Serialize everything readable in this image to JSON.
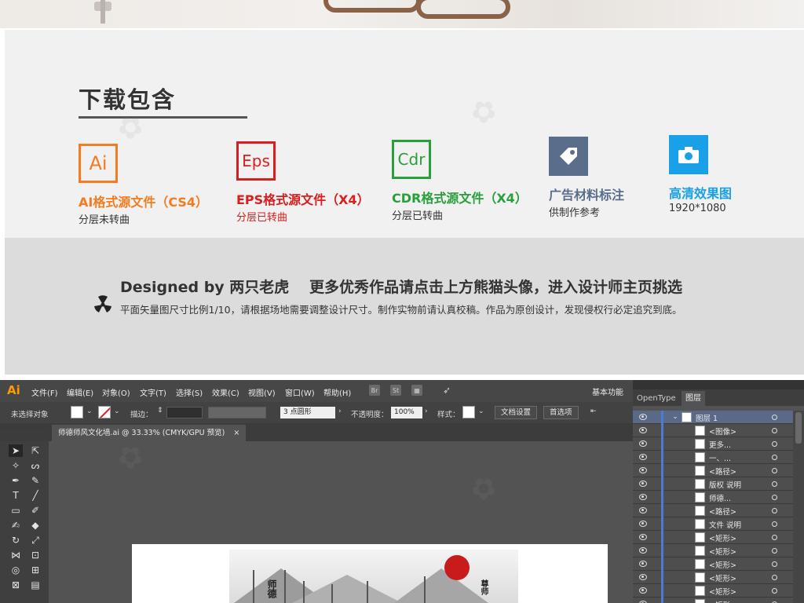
{
  "download": {
    "title": "下载包含",
    "items": [
      {
        "icon_text": "Ai",
        "color": "#f47b20",
        "name": "AI格式源文件（CS4）",
        "sub": "分层未转曲"
      },
      {
        "icon_text": "Eps",
        "color": "#d81e1e",
        "name": "EPS格式源文件（X4）",
        "sub": "分层已转曲"
      },
      {
        "icon_text": "Cdr",
        "color": "#28a03a",
        "name": "CDR格式源文件（X4）",
        "sub": "分层已转曲"
      },
      {
        "icon": "tag-icon",
        "color": "#5a6e8c",
        "name": "广告材料标注",
        "sub": "供制作参考"
      },
      {
        "icon": "camera-icon",
        "color": "#1aa0e6",
        "name": "高清效果图",
        "sub": "1920*1080"
      }
    ]
  },
  "banner": {
    "designer": "Designed by 两只老虎",
    "promo": "更多优秀作品请点击上方熊猫头像，进入设计师主页挑选",
    "note": "平面矢量图尺寸比例1/10，请根据场地需要调整设计尺寸。制作实物前请认真校稿。作品为原创设计，发现侵权行必定追究到底。"
  },
  "illustrator": {
    "logo": "Ai",
    "menu": [
      "文件(F)",
      "编辑(E)",
      "对象(O)",
      "文字(T)",
      "选择(S)",
      "效果(C)",
      "视图(V)",
      "窗口(W)",
      "帮助(H)"
    ],
    "menu_icons": [
      "Br",
      "St"
    ],
    "workspace": "基本功能",
    "control": {
      "no_selection": "未选择对象",
      "stroke_label": "描边：",
      "brush": "3 点圆形",
      "opacity_label": "不透明度：",
      "opacity_value": "100%",
      "style_label": "样式：",
      "doc_settings": "文档设置",
      "preferences": "首选项"
    },
    "document_tab": "师德师风文化墙.ai @ 33.33% (CMYK/GPU 预览)",
    "tab_close": "×",
    "artwork": {
      "left_title": "师德",
      "right_title": "尊师"
    }
  },
  "panels": {
    "tabs": [
      "OpenType",
      "图层"
    ],
    "active_tab": "图层",
    "layers": [
      {
        "label": "图层 1",
        "main": true
      },
      {
        "label": "<图像>"
      },
      {
        "label": "更多..."
      },
      {
        "label": "一、..."
      },
      {
        "label": "<路径>"
      },
      {
        "label": "版权 说明"
      },
      {
        "label": "师德..."
      },
      {
        "label": "<路径>"
      },
      {
        "label": "文件 说明"
      },
      {
        "label": "<矩形>"
      },
      {
        "label": "<矩形>"
      },
      {
        "label": "<矩形>"
      },
      {
        "label": "<矩形>"
      },
      {
        "label": "<矩形>"
      },
      {
        "label": "<矩形>"
      }
    ]
  }
}
